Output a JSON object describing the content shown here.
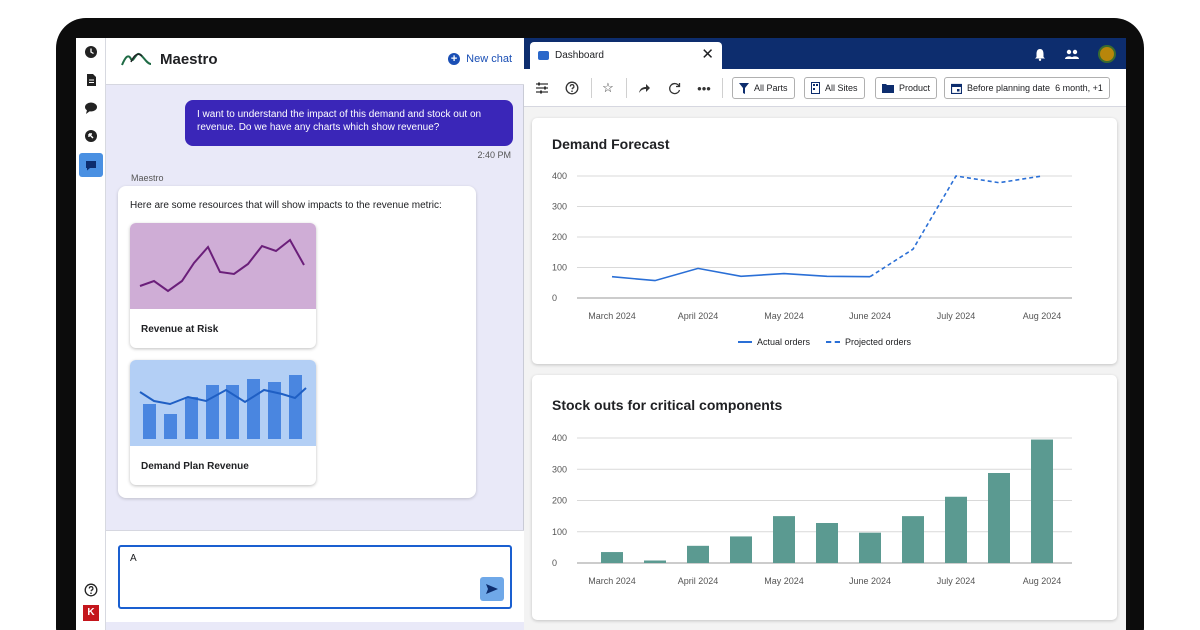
{
  "app": {
    "name": "Maestro",
    "new_chat_label": "New chat"
  },
  "rail": {
    "items": [
      "clock-icon",
      "document-icon",
      "comment-icon",
      "arrow-circle-icon",
      "chat-icon"
    ],
    "help_icon": "help-icon",
    "brand_badge": "K"
  },
  "chat": {
    "user_message": "I want to understand the impact of this demand and stock out on revenue. Do we have any charts which show revenue?",
    "user_time": "2:40 PM",
    "bot_sender": "Maestro",
    "bot_text": "Here are some resources that will show impacts to the revenue metric:",
    "resources": [
      {
        "label": "Revenue at Risk",
        "thumb_color": "#cfadd6",
        "line_color": "#6b1f7a"
      },
      {
        "label": "Demand Plan Revenue",
        "thumb_color": "#b3cff5",
        "bar_color": "#4a86e0",
        "line_color": "#1f5fc4"
      }
    ],
    "input_value": "A"
  },
  "dashboard": {
    "tab_label": "Dashboard",
    "filters": {
      "parts": "All Parts",
      "sites": "All Sites",
      "product": "Product",
      "date": "Before planning date",
      "date_value": "6 month, +1"
    }
  },
  "chart_data": [
    {
      "type": "line",
      "title": "Demand Forecast",
      "x": [
        "March 2024",
        "April 2024",
        "May 2024",
        "June 2024",
        "July 2024",
        "Aug 2024"
      ],
      "ylim": [
        0,
        400
      ],
      "yticks": [
        0,
        100,
        200,
        300,
        400
      ],
      "grid": true,
      "legend_position": "bottom",
      "series": [
        {
          "name": "Actual orders",
          "style": "solid",
          "color": "#2a6fd6",
          "points": [
            [
              0,
              70
            ],
            [
              0.5,
              57
            ],
            [
              1,
              97
            ],
            [
              1.5,
              71
            ],
            [
              2,
              80
            ],
            [
              2.5,
              71
            ],
            [
              3,
              70
            ]
          ]
        },
        {
          "name": "Projected orders",
          "style": "dashed",
          "color": "#2a6fd6",
          "points": [
            [
              3,
              70
            ],
            [
              3.5,
              160
            ],
            [
              4,
              400
            ],
            [
              4.5,
              378
            ],
            [
              5,
              400
            ]
          ]
        }
      ]
    },
    {
      "type": "bar",
      "title": "Stock outs for critical components",
      "categories": [
        "March 2024",
        "April 2024",
        "May 2024",
        "June 2024",
        "July 2024",
        "Aug 2024"
      ],
      "ylim": [
        0,
        400
      ],
      "yticks": [
        0,
        100,
        200,
        300,
        400
      ],
      "grid": true,
      "color": "#5b9a91",
      "bar_positions": [
        0,
        0.5,
        1,
        1.5,
        2,
        2.5,
        3,
        3.5,
        4,
        4.5,
        5
      ],
      "values": [
        35,
        8,
        55,
        85,
        150,
        128,
        97,
        150,
        212,
        288,
        395
      ]
    }
  ]
}
